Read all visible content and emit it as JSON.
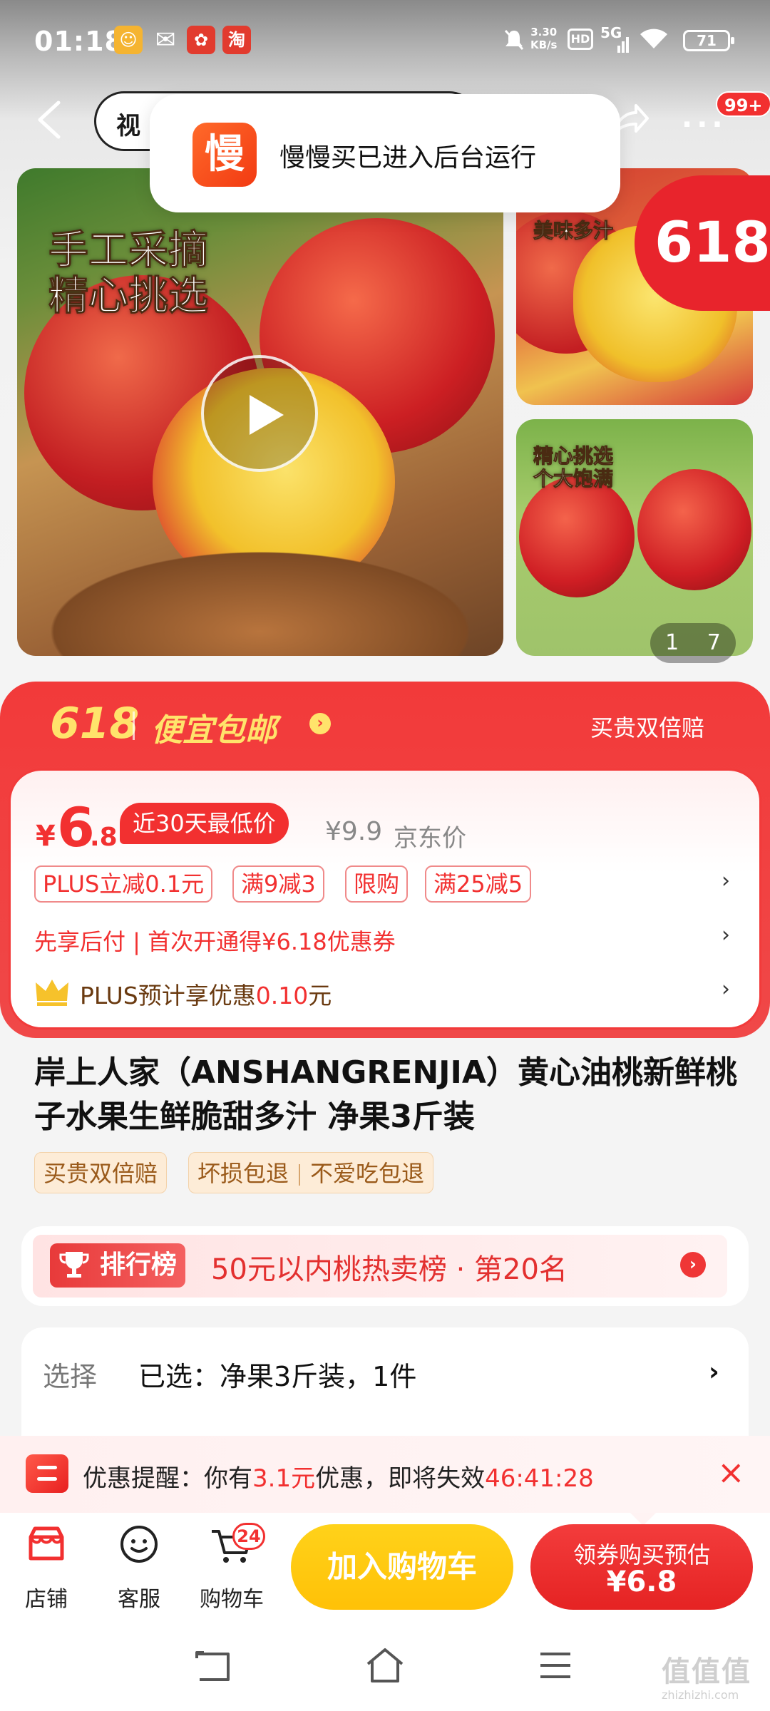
{
  "status_bar": {
    "time": "01:18",
    "net_speed": "3.30",
    "net_unit": "KB/s",
    "hd": "HD",
    "signal": "5G",
    "battery": "71"
  },
  "toast": {
    "logo_char": "慢",
    "text": "慢慢买已进入后台运行"
  },
  "header": {
    "search_partial": "视",
    "more_badge": "99+"
  },
  "gallery": {
    "main_overlay_line1": "手工采摘",
    "main_overlay_line2": "精心挑选",
    "side1_overlay": "美味多汁",
    "side2_overlay_line1": "精心挑选",
    "side2_overlay_line2": "个大饱满",
    "badge_618": "618",
    "pager_current": "1",
    "pager_total": "7"
  },
  "promo": {
    "event": "618",
    "title": "便宜包邮",
    "arrow": "›",
    "right_text": "买贵双倍赔"
  },
  "price": {
    "yen": "¥",
    "integer": "6",
    "decimal": ".8",
    "low_tag": "近30天最低价",
    "jd_price": "¥9.9",
    "jd_label": "京东价",
    "tags": [
      "PLUS立减0.1元",
      "满9减3",
      "限购",
      "满25减5"
    ],
    "pay_later": "先享后付 | 首次开通得¥6.18优惠券",
    "plus_prefix": "PLUS预计享优惠",
    "plus_amount": "0.10",
    "plus_suffix": "元",
    "chevron": "›"
  },
  "product": {
    "title": "岸上人家（ANSHANGRENJIA）黄心油桃新鲜桃子水果生鲜脆甜多汁 净果3斤装",
    "service_tags": [
      "买贵双倍赔",
      "坏损包退",
      "不爱吃包退"
    ]
  },
  "ranking": {
    "badge": "排行榜",
    "text": "50元以内桃热卖榜 · 第20名",
    "go": "›"
  },
  "selection": {
    "label": "选择",
    "value": "已选：净果3斤装，1件",
    "chevron": "›"
  },
  "reminder": {
    "prefix": "优惠提醒：你有",
    "amount": "3.1元",
    "mid": "优惠，即将失效",
    "countdown": "46:41:28",
    "close": "×"
  },
  "action_bar": {
    "shop_label": "店铺",
    "service_label": "客服",
    "cart_label": "购物车",
    "cart_count": "24",
    "add_cart": "加入购物车",
    "buy_line1": "领券购买预估",
    "buy_line2": "¥6.8"
  },
  "watermark": {
    "text": "值值值",
    "sub": "zhizhizhi.com"
  },
  "colors": {
    "jd_red": "#f23030",
    "cart_yellow": "#ffc107",
    "gold": "#ffe36b"
  }
}
